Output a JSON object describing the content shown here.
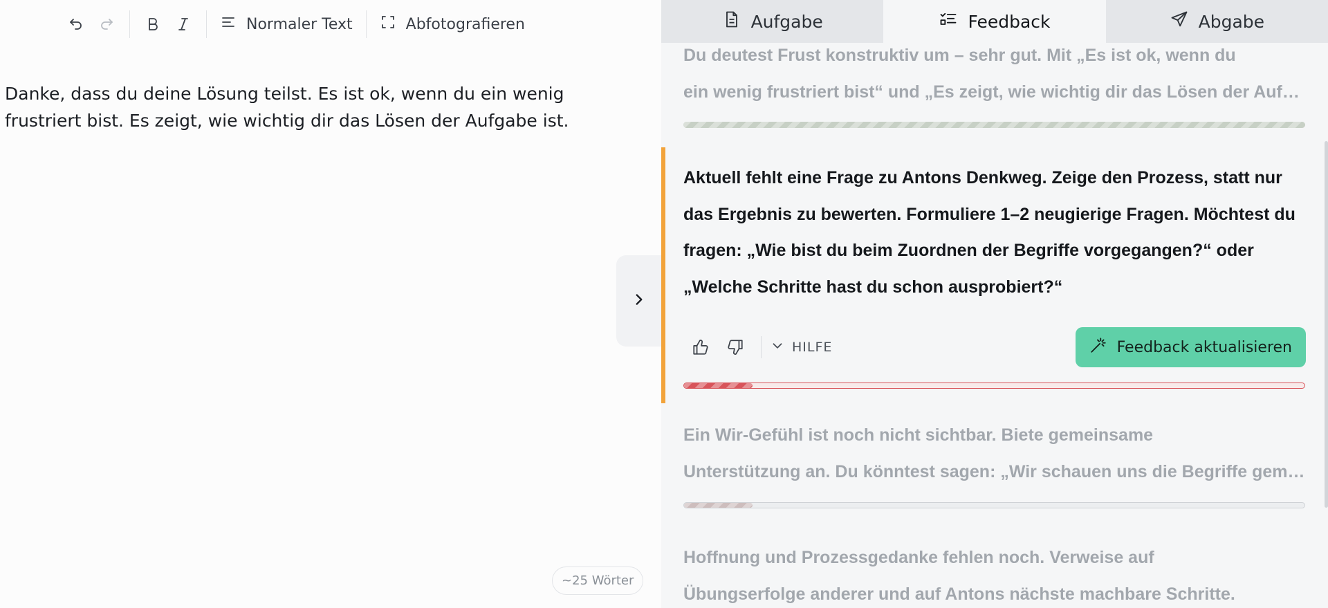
{
  "toolbar": {
    "undo_icon": "undo-icon",
    "redo_icon": "redo-icon",
    "bold_icon": "bold-icon",
    "italic_icon": "italic-icon",
    "text_style_label": "Normaler Text",
    "photo_label": "Abfotografieren"
  },
  "editor": {
    "text": "Danke, dass du deine Lösung teilst. Es ist ok, wenn du ein wenig frustriert bist. Es zeigt, wie wichtig dir das Lösen der Aufgabe ist.",
    "word_count": "~25 Wörter"
  },
  "tabs": [
    {
      "label": "Aufgabe",
      "icon": "document-icon",
      "active": false
    },
    {
      "label": "Feedback",
      "icon": "checklist-icon",
      "active": true
    },
    {
      "label": "Abgabe",
      "icon": "send-icon",
      "active": false
    }
  ],
  "feedback": {
    "items": [
      {
        "text": "Du deutest Frust konstruktiv um – sehr gut. Mit „Es ist ok, wenn du ein wenig frustriert bist“ und „Es zeigt, wie wichtig dir das Lösen der Aufgabe ist“",
        "line1": "Du deutest Frust konstruktiv um – sehr gut. Mit „Es ist ok, wenn du",
        "line2": "ein wenig frustriert bist“ und „Es zeigt, wie wichtig dir das Lösen der Aufgabe ist“",
        "progress": 1.0,
        "state": "done"
      },
      {
        "text": "Aktuell fehlt eine Frage zu Antons Denkweg. Zeige den Prozess, statt nur das Ergebnis zu bewerten. Formuliere 1–2 neugierige Fragen. Möchtest du fragen: „Wie bist du beim Zuordnen der Begriffe vorgegangen?“ oder „Welche Schritte hast du schon ausprobiert?“",
        "progress": 0.11,
        "state": "active"
      },
      {
        "text": "Ein Wir-Gefühl ist noch nicht sichtbar. Biete gemeinsame Unterstützung an. Du könntest sagen: „Wir schauen uns die Begriffe gemeinsam an“",
        "line1": "Ein Wir-Gefühl ist noch nicht sichtbar. Biete gemeinsame",
        "line2": "Unterstützung an. Du könntest sagen: „Wir schauen uns die Begriffe gemeinsam an“",
        "progress": 0.11,
        "state": "pending"
      },
      {
        "text": "Hoffnung und Prozessgedanke fehlen noch. Verweise auf Übungserfolge anderer und auf Antons nächste machbare Schritte.",
        "line1": "Hoffnung und Prozessgedanke fehlen noch. Verweise auf",
        "line2": "Übungserfolge anderer und auf Antons nächste machbare Schritte.",
        "progress": 0,
        "state": "pending"
      }
    ],
    "help_label": "HILFE",
    "update_button": "Feedback aktualisieren"
  },
  "colors": {
    "accent": "#f2a33a",
    "button": "#5fd0a8",
    "progress_done": "#c7d0c5",
    "progress_active": "#d8545a"
  }
}
